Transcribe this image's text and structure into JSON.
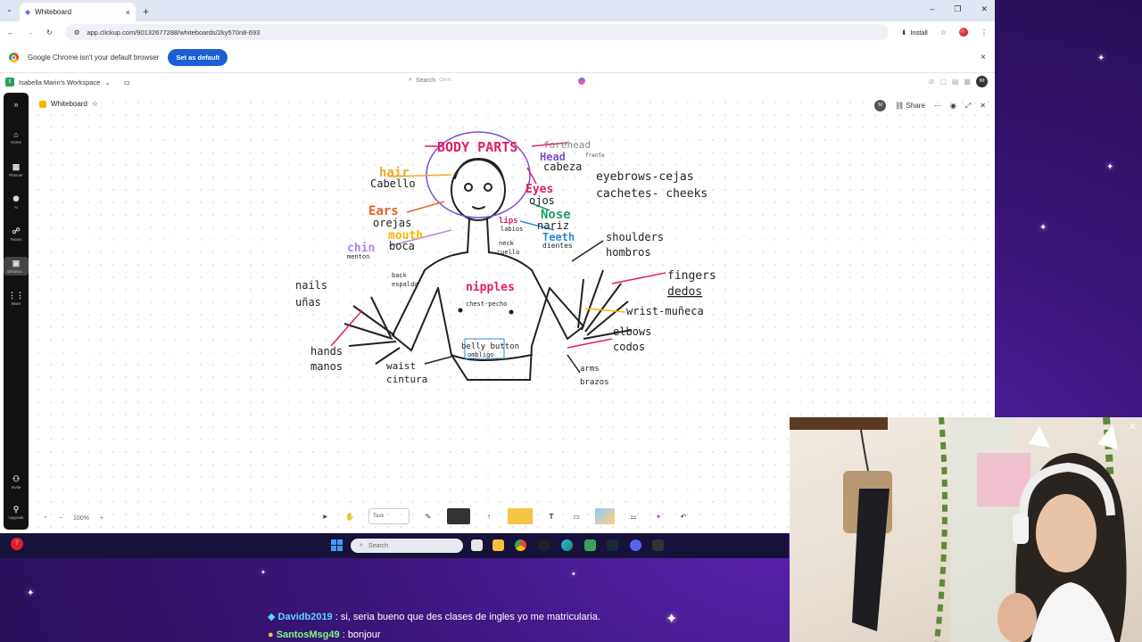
{
  "browser": {
    "tab_title": "Whiteboard",
    "tab_close": "×",
    "new_tab": "+",
    "url": "app.clickup.com/90132677288/whiteboards/2ky570n8-693",
    "install_label": "Install",
    "default_bar": {
      "message": "Google Chrome isn't your default browser",
      "button": "Set as default",
      "close": "×"
    }
  },
  "clickup": {
    "workspace_initial": "I",
    "workspace": "Isabella Marin's Workspace",
    "search_placeholder": "Search",
    "search_shortcut": "Ctrl K",
    "avatar": "IM",
    "rail": [
      {
        "icon": "home-icon",
        "label": "Home"
      },
      {
        "icon": "planner-icon",
        "label": "Planner"
      },
      {
        "icon": "ai-icon",
        "label": "AI"
      },
      {
        "icon": "teams-icon",
        "label": "Teams"
      },
      {
        "icon": "whiteboard-icon",
        "label": "Whitebo..."
      },
      {
        "icon": "more-icon",
        "label": "More"
      },
      {
        "icon": "invite-icon",
        "label": "Invite"
      },
      {
        "icon": "upgrade-icon",
        "label": "Upgrade"
      }
    ],
    "whiteboard": {
      "title": "Whiteboard",
      "share": "Share",
      "zoom": "100%",
      "task_label": "Task"
    }
  },
  "drawing": {
    "title": "BODY PARTS",
    "labels": {
      "forehead": "forehead",
      "frente": "frente",
      "head": "Head",
      "cabeza": "cabeza",
      "hair": "hair",
      "cabello": "Cabello",
      "eyebrows": "eyebrows-cejas",
      "cheeks": "cachetes- cheeks",
      "eyes": "Eyes",
      "ojos": "ojos",
      "ears": "Ears",
      "orejas": "orejas",
      "nose": "Nose",
      "nariz": "nariz",
      "lips": "lips",
      "labios": "labios",
      "mouth": "mouth",
      "boca": "boca",
      "chin": "chin",
      "menton": "menton",
      "neck": "neck",
      "cuello": "cuello",
      "teeth": "Teeth",
      "dientes": "dientes",
      "shoulders": "shoulders",
      "hombros": "hombros",
      "back": "back",
      "espalda": "espalda",
      "nipples": "nipples",
      "chest": "chest-pecho",
      "fingers": "fingers",
      "dedos": "dedos",
      "nails": "nails",
      "unas": "uñas",
      "wrist": "wrist-muñeca",
      "elbows": "elbows",
      "codos": "codos",
      "hands": "hands",
      "manos": "manos",
      "belly": "belly button",
      "ombligo": "ombligo",
      "waist": "waist",
      "cintura": "cintura",
      "arms": "arms",
      "brazos": "brazos"
    }
  },
  "taskbar": {
    "search": "Search",
    "badge": "7"
  },
  "chat": [
    {
      "user": "Davidb2019",
      "message": ": si, seria bueno que des clases de ingles yo me matricularia."
    },
    {
      "user": "SantosMsg49",
      "message": ": bonjour"
    }
  ]
}
